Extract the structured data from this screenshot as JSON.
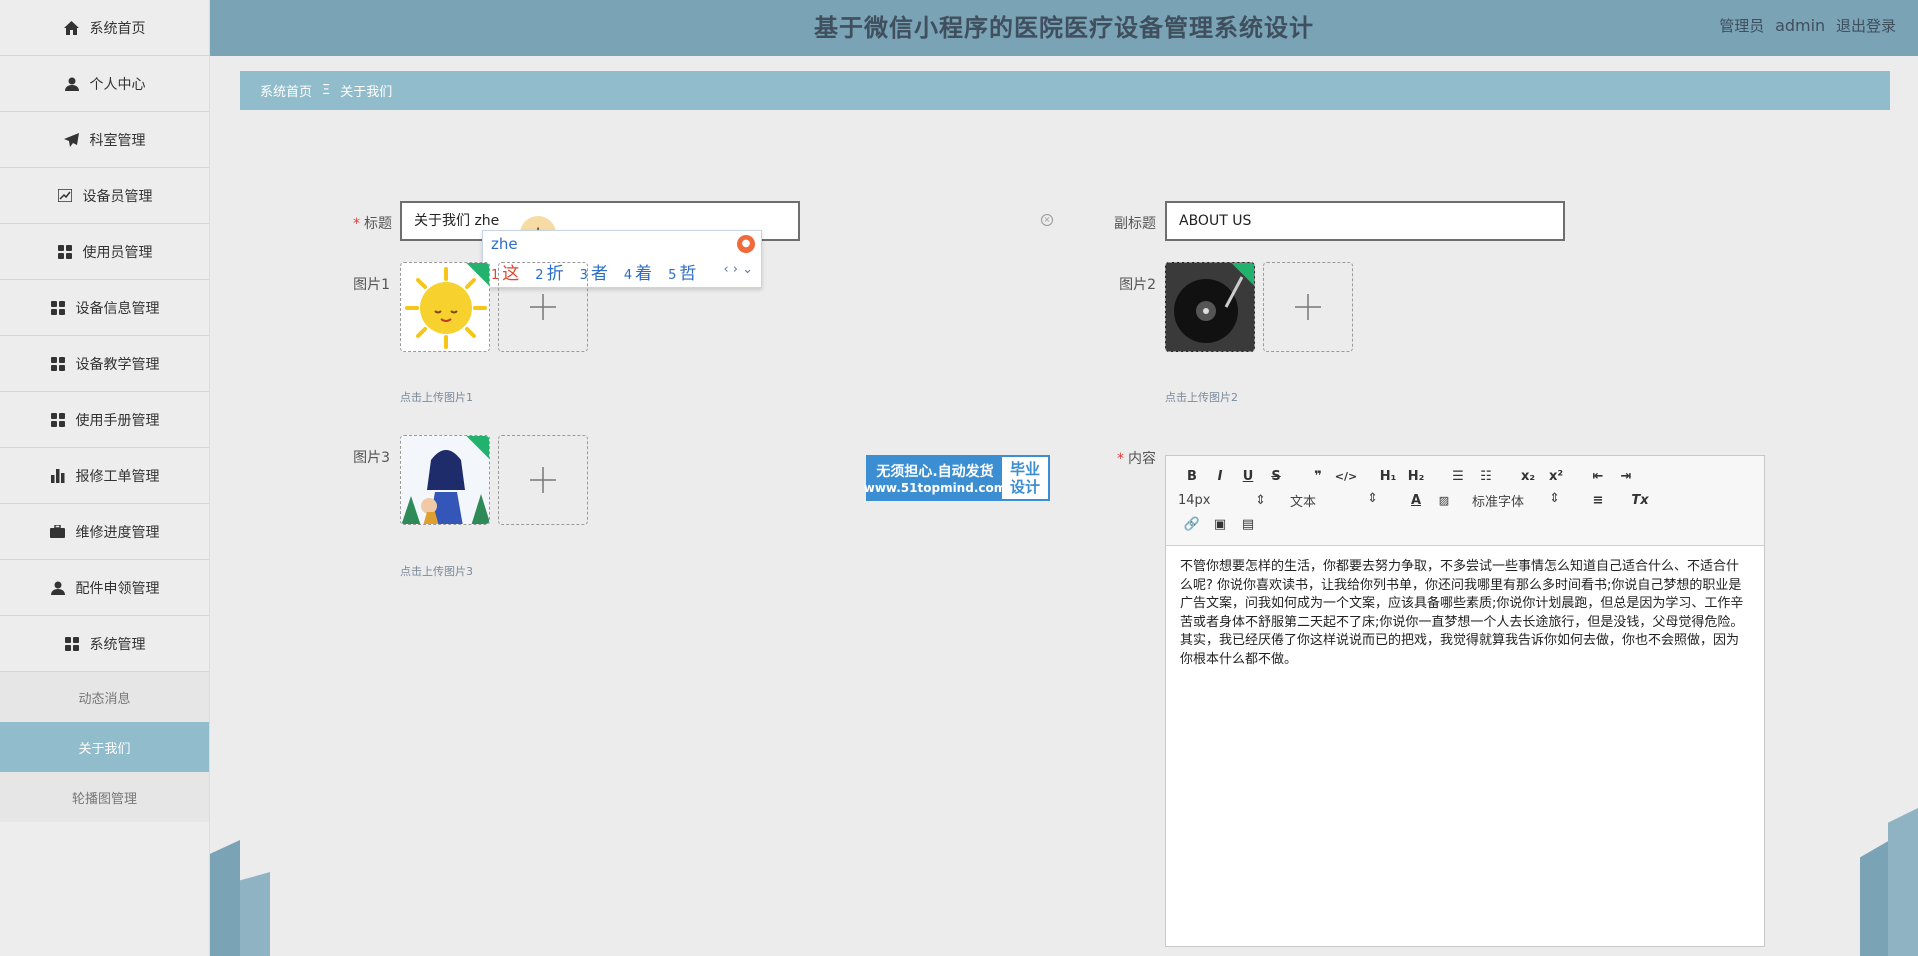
{
  "sidebar": {
    "items": [
      {
        "label": "系统首页",
        "icon": "home-icon"
      },
      {
        "label": "个人中心",
        "icon": "user-icon"
      },
      {
        "label": "科室管理",
        "icon": "send-icon"
      },
      {
        "label": "设备员管理",
        "icon": "chart-icon"
      },
      {
        "label": "使用员管理",
        "icon": "grid-icon"
      },
      {
        "label": "设备信息管理",
        "icon": "grid-icon"
      },
      {
        "label": "设备教学管理",
        "icon": "grid-icon"
      },
      {
        "label": "使用手册管理",
        "icon": "grid-icon"
      },
      {
        "label": "报修工单管理",
        "icon": "bar-chart-icon"
      },
      {
        "label": "维修进度管理",
        "icon": "briefcase-icon"
      },
      {
        "label": "配件申领管理",
        "icon": "user-icon"
      },
      {
        "label": "系统管理",
        "icon": "grid-icon"
      }
    ],
    "sub_items": [
      {
        "label": "动态消息"
      },
      {
        "label": "关于我们"
      },
      {
        "label": "轮播图管理"
      }
    ]
  },
  "header": {
    "title": "基于微信小程序的医院医疗设备管理系统设计",
    "role": "管理员",
    "username": "admin",
    "logout": "退出登录"
  },
  "breadcrumb": {
    "home": "系统首页",
    "separator": "Ξ",
    "current": "关于我们"
  },
  "form": {
    "title_label": "标题",
    "title_value": "关于我们 zhe",
    "subtitle_label": "副标题",
    "subtitle_value": "ABOUT US",
    "pic1_label": "图片1",
    "pic1_hint": "点击上传图片1",
    "pic2_label": "图片2",
    "pic2_hint": "点击上传图片2",
    "pic3_label": "图片3",
    "pic3_hint": "点击上传图片3",
    "content_label": "内容"
  },
  "ime": {
    "composition": "zhe",
    "candidates": [
      {
        "n": "1",
        "text": "这"
      },
      {
        "n": "2",
        "text": "折"
      },
      {
        "n": "3",
        "text": "者"
      },
      {
        "n": "4",
        "text": "着"
      },
      {
        "n": "5",
        "text": "哲"
      }
    ]
  },
  "watermark": {
    "line1": "无须担心.自动发货",
    "line2": "www.51topmind.com",
    "right1": "毕业",
    "right2": "设计"
  },
  "editor": {
    "font_size": "14px",
    "block_type": "文本",
    "font_family": "标准字体",
    "content": "不管你想要怎样的生活，你都要去努力争取，不多尝试一些事情怎么知道自己适合什么、不适合什么呢? 你说你喜欢读书，让我给你列书单，你还问我哪里有那么多时间看书;你说自己梦想的职业是广告文案，问我如何成为一个文案，应该具备哪些素质;你说你计划晨跑，但总是因为学习、工作辛苦或者身体不舒服第二天起不了床;你说你一直梦想一个人去长途旅行，但是没钱，父母觉得危险。其实，我已经厌倦了你这样说说而已的把戏，我觉得就算我告诉你如何去做，你也不会照做，因为你根本什么都不做。"
  },
  "colors": {
    "header_bg": "#7aa3b5",
    "breadcrumb_bg": "#91bccb",
    "active_sub_bg": "#91bccb",
    "required": "#e03b3b"
  }
}
